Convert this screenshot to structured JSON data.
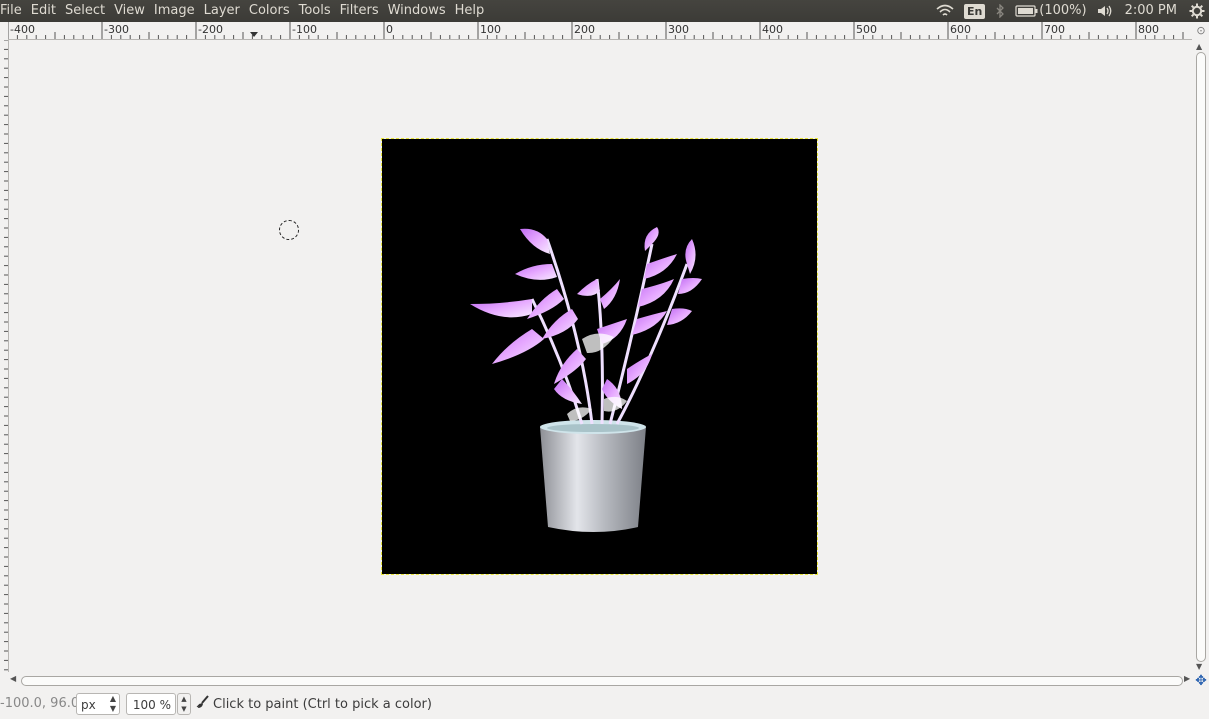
{
  "menubar": {
    "items": [
      "File",
      "Edit",
      "Select",
      "View",
      "Image",
      "Layer",
      "Colors",
      "Tools",
      "Filters",
      "Windows",
      "Help"
    ],
    "keyboard_layout": "En",
    "battery_text": "(100%)",
    "clock": "2:00 PM"
  },
  "ruler": {
    "labels": [
      "-400",
      "-300",
      "-200",
      "-100",
      "0",
      "100",
      "200",
      "300",
      "400",
      "500",
      "600",
      "700",
      "800"
    ]
  },
  "canvas": {
    "image_description_icon": "plant-image",
    "background_color": "#000000"
  },
  "statusbar": {
    "coords": "-100.0, 96.0",
    "unit": "px",
    "zoom": "100 %",
    "message": "Click to paint (Ctrl to pick a color)"
  }
}
